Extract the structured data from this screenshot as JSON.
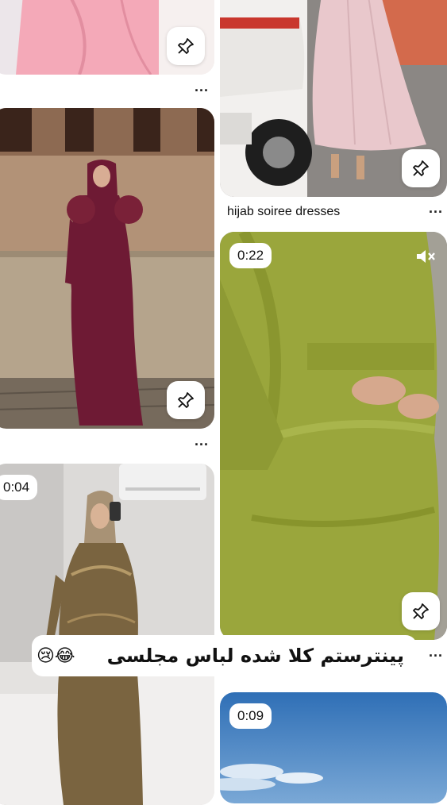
{
  "feed": {
    "pins": [
      {
        "id": "pin-pink-dress"
      },
      {
        "id": "pin-lilac-dress",
        "title": "hijab soiree dresses"
      },
      {
        "id": "pin-burgundy-dress"
      },
      {
        "id": "pin-green-dress",
        "duration": "0:22"
      },
      {
        "id": "pin-gold-dress",
        "duration": "0:04"
      },
      {
        "id": "pin-sky",
        "duration": "0:09"
      }
    ],
    "more_label": "...",
    "caption": {
      "text": "پینترستم کلا شده لباس مجلسی",
      "emoji": "😢😂"
    }
  },
  "icons": {
    "save": "pin-icon",
    "more": "more-options-icon",
    "mute": "speaker-muted-icon"
  },
  "colors": {
    "background": "#ffffff",
    "pink_dress": "#f2a9b8",
    "lilac_dress": "#e9c8cc",
    "burgundy_dress": "#6e1a34",
    "green_dress": "#9aa63c",
    "gold_dress": "#7a6440",
    "sky": "#4a86c4"
  }
}
